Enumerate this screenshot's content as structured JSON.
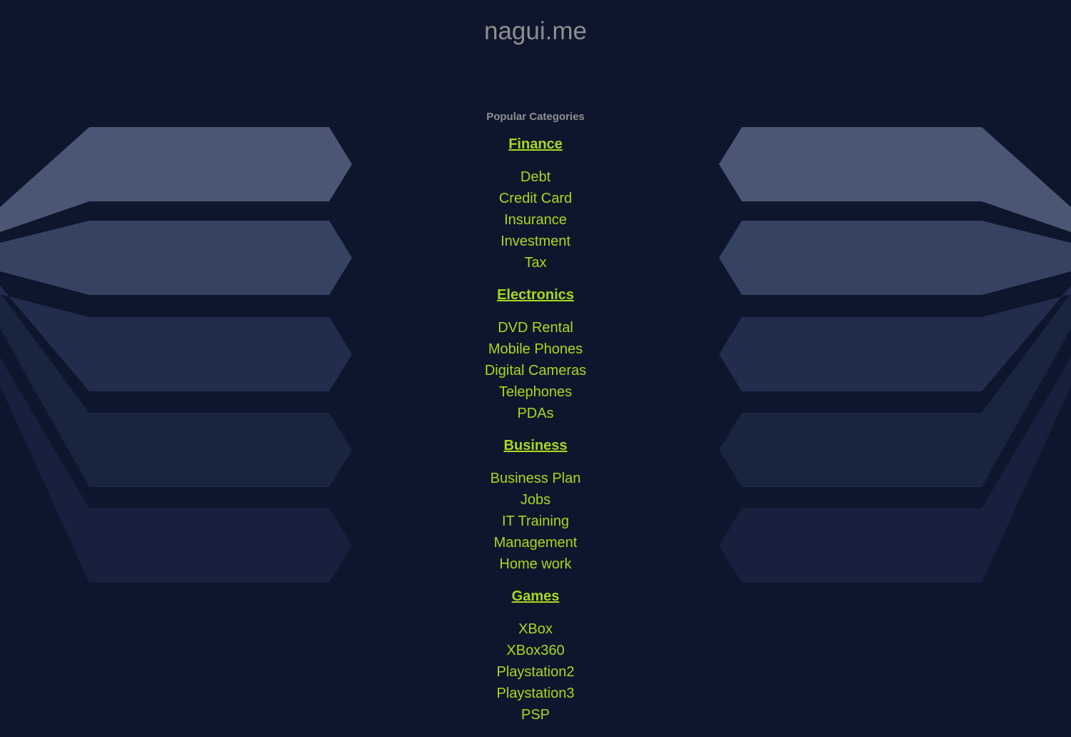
{
  "page": {
    "site_title": "nagui.me",
    "categories_heading": "Popular Categories"
  },
  "colors": {
    "background": "#0e162d",
    "link": "#a7d91e",
    "muted_text": "#8e8e8e"
  },
  "categories": [
    {
      "title": "Finance",
      "links": [
        "Debt",
        "Credit Card",
        "Insurance",
        "Investment",
        "Tax"
      ]
    },
    {
      "title": "Electronics",
      "links": [
        "DVD Rental",
        "Mobile Phones",
        "Digital Cameras",
        "Telephones",
        "PDAs"
      ]
    },
    {
      "title": "Business",
      "links": [
        "Business Plan",
        "Jobs",
        "IT Training",
        "Management",
        "Home work"
      ]
    },
    {
      "title": "Games",
      "links": [
        "XBox",
        "XBox360",
        "Playstation2",
        "Playstation3",
        "PSP"
      ]
    }
  ]
}
